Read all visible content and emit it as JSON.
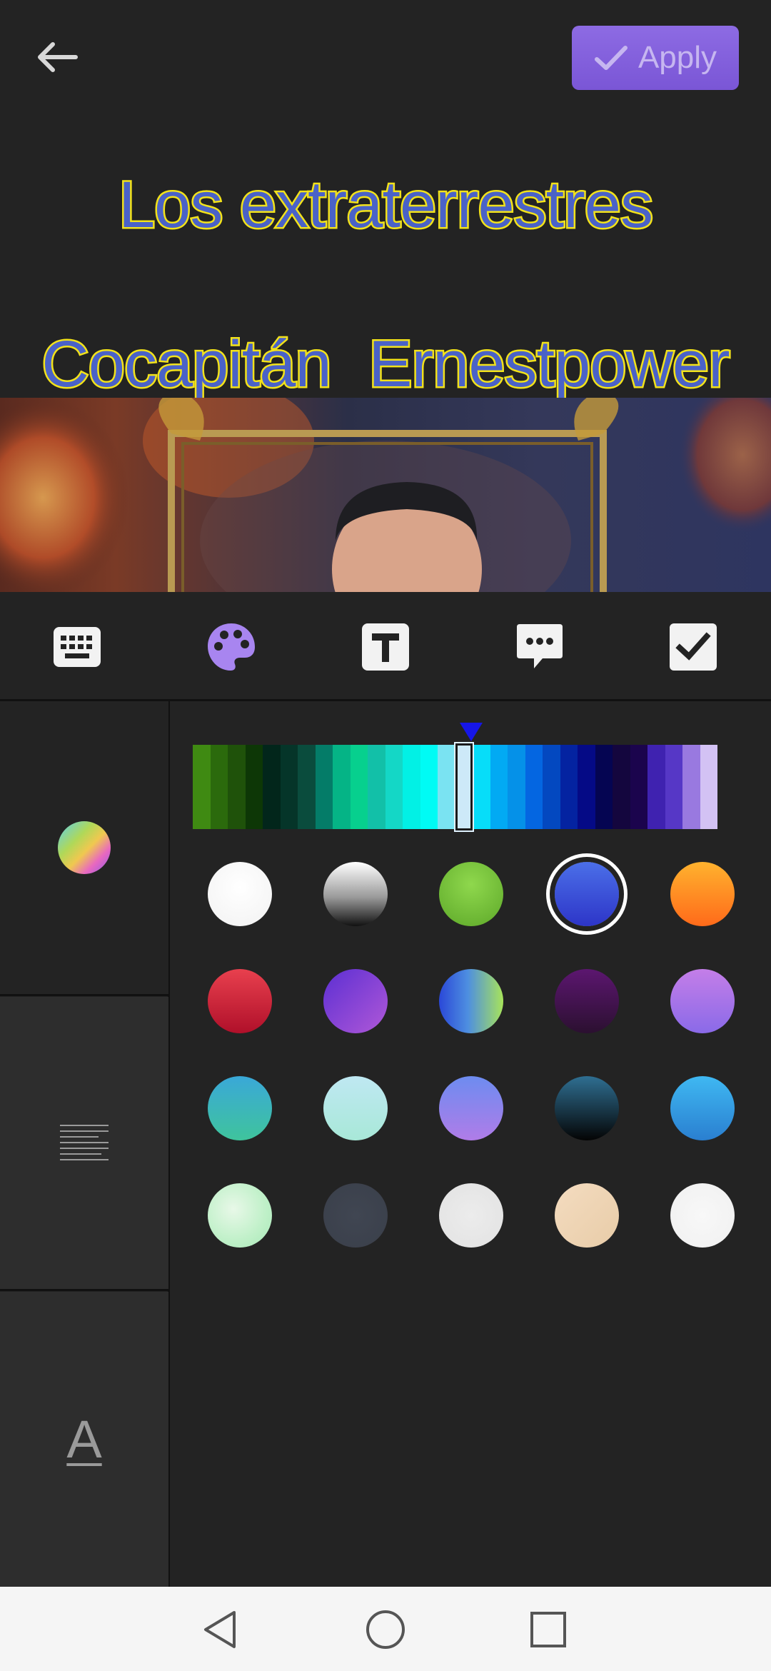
{
  "header": {
    "apply_label": "Apply"
  },
  "caption": {
    "line1": "Los extraterrestres",
    "line2": "Cocapitán  Ernestpower"
  },
  "toolbar": {
    "items": [
      "keyboard-icon",
      "palette-icon",
      "text-format-icon",
      "speech-bubble-icon",
      "checkbox-icon"
    ],
    "active_index": 1,
    "active_color": "#a885f0"
  },
  "left_panel": {
    "tabs": [
      "color-tab",
      "alignment-tab",
      "font-tab"
    ],
    "font_tab_glyph": "A"
  },
  "color_strip": {
    "colors": [
      "#3f8a12",
      "#2b6a0c",
      "#1f520a",
      "#0d3706",
      "#02261b",
      "#053529",
      "#0a4c3d",
      "#047c68",
      "#05b486",
      "#07d08e",
      "#12c0a8",
      "#14d7c6",
      "#02f0e5",
      "#00fbf5",
      "#7ae3f2",
      "#cde9f8",
      "#07ddf9",
      "#02aaf3",
      "#0591e8",
      "#0466e1",
      "#0348c0",
      "#0423a1",
      "#050a86",
      "#050552",
      "#14063e",
      "#1b044d",
      "#3f22b0",
      "#5637c6",
      "#9979e0",
      "#d3c2f4"
    ],
    "selected_index": 15
  },
  "swatches": [
    {
      "name": "swatch-white",
      "bg": "radial-gradient(circle at 50% 40%, #ffffff, #f2f2f2)"
    },
    {
      "name": "swatch-silver",
      "bg": "linear-gradient(180deg, #ffffff 0%, #9a9a9a 55%, #111111 100%)"
    },
    {
      "name": "swatch-green",
      "bg": "radial-gradient(circle at 50% 35%, #8fd84d, #5da829)"
    },
    {
      "name": "swatch-blue",
      "bg": "linear-gradient(180deg, #4b6fe8 0%, #2d35c8 100%)",
      "selected": true
    },
    {
      "name": "swatch-orange",
      "bg": "linear-gradient(180deg, #ffb22e 0%, #ff6a1a 100%)"
    },
    {
      "name": "swatch-red",
      "bg": "linear-gradient(180deg, #e8404e 0%, #b0102a 100%)"
    },
    {
      "name": "swatch-purple",
      "bg": "linear-gradient(135deg, #5c2fd2 0%, #b058d8 100%)"
    },
    {
      "name": "swatch-blue-green",
      "bg": "linear-gradient(90deg, #2a48d8 0%, #4e8fe0 45%, #a8e45a 100%)"
    },
    {
      "name": "swatch-plum",
      "bg": "linear-gradient(180deg, #5c1670 0%, #2b1030 100%)"
    },
    {
      "name": "swatch-lavender",
      "bg": "linear-gradient(180deg, #c47ee8 0%, #8a6ae8 100%)"
    },
    {
      "name": "swatch-teal",
      "bg": "linear-gradient(180deg, #3aa8d8 0%, #3fc49c 100%)"
    },
    {
      "name": "swatch-mint",
      "bg": "linear-gradient(180deg, #bfe8f2 0%, #a8e8d8 100%)"
    },
    {
      "name": "swatch-periwinkle",
      "bg": "linear-gradient(180deg, #6d8cf0 0%, #b07ce8 100%)"
    },
    {
      "name": "swatch-navy",
      "bg": "linear-gradient(180deg, #2f6f92 0%, #040404 100%)"
    },
    {
      "name": "swatch-sky",
      "bg": "linear-gradient(180deg, #3fb8f2 0%, #2a7fd0 100%)"
    },
    {
      "name": "swatch-pale-green",
      "bg": "radial-gradient(circle at 40% 40%, #e8f8e8 0%, #bff0c8 60%, #a8e8b8 100%)"
    },
    {
      "name": "swatch-slate",
      "bg": "radial-gradient(circle, #404652 0%, #3a3f4a 100%)"
    },
    {
      "name": "swatch-light-gray",
      "bg": "radial-gradient(circle, #ececec 0%, #e2e2e2 100%)"
    },
    {
      "name": "swatch-beige",
      "bg": "linear-gradient(135deg, #f4dcc0 0%, #e8cca8 100%)"
    },
    {
      "name": "swatch-off-white",
      "bg": "radial-gradient(circle, #f8f8f8 0%, #f0f0f0 100%)"
    }
  ],
  "navbar": {
    "items": [
      "back-triangle-icon",
      "home-circle-icon",
      "recents-square-icon"
    ]
  }
}
